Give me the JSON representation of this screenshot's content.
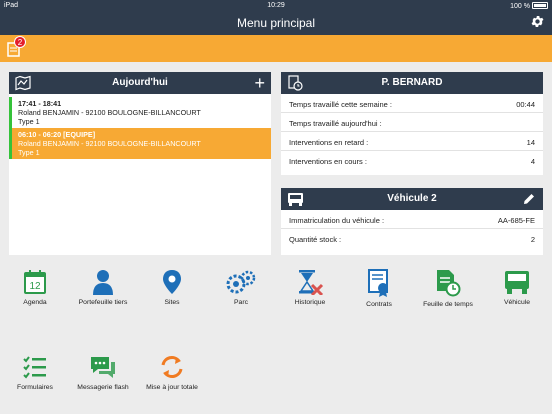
{
  "status": {
    "carrier": "iPad",
    "time": "10:29",
    "battery_pct": "100 %"
  },
  "nav": {
    "title": "Menu principal"
  },
  "notifications": {
    "count": "2"
  },
  "today": {
    "title": "Aujourd'hui",
    "appointments": [
      {
        "time": "17:41 - 18:41",
        "client": "Roland BENJAMIN - 92100 BOULOGNE-BILLANCOURT",
        "type": "Type 1",
        "selected": false
      },
      {
        "time": "06:10 - 06:20 [EQUIPE]",
        "client": "Roland BENJAMIN - 92100 BOULOGNE-BILLANCOURT",
        "type": "Type 1",
        "selected": true
      }
    ]
  },
  "user": {
    "name": "P. BERNARD",
    "rows": [
      {
        "label": "Temps travaillé cette semaine :",
        "value": "00:44"
      },
      {
        "label": "Temps travaillé aujourd'hui :",
        "value": ""
      },
      {
        "label": "Interventions en retard :",
        "value": "14"
      },
      {
        "label": "Interventions en cours :",
        "value": "4"
      }
    ]
  },
  "vehicle": {
    "title": "Véhicule 2",
    "rows": [
      {
        "label": "Immatriculation du véhicule :",
        "value": "AA-685-FE"
      },
      {
        "label": "Quantité stock :",
        "value": "2"
      }
    ]
  },
  "tiles": [
    {
      "label": "Agenda",
      "icon": "calendar-icon",
      "calendar_day": "12"
    },
    {
      "label": "Portefeuille tiers",
      "icon": "person-icon"
    },
    {
      "label": "Sites",
      "icon": "location-pin-icon"
    },
    {
      "label": "Parc",
      "icon": "gears-icon"
    },
    {
      "label": "Historique",
      "icon": "hourglass-tools-icon"
    },
    {
      "label": "Contrats",
      "icon": "contract-icon"
    },
    {
      "label": "Feuille de temps",
      "icon": "timesheet-icon"
    },
    {
      "label": "Véhicule",
      "icon": "truck-icon"
    },
    {
      "label": "Formulaires",
      "icon": "checklist-icon"
    },
    {
      "label": "Messagerie flash",
      "icon": "chat-icon"
    },
    {
      "label": "Mise à jour totale",
      "icon": "sync-icon"
    }
  ],
  "colors": {
    "header": "#2f3c4d",
    "accent_orange": "#f7a934",
    "green": "#35c23a",
    "tile_blue": "#1e6fb8",
    "badge_red": "#e41f2b"
  }
}
